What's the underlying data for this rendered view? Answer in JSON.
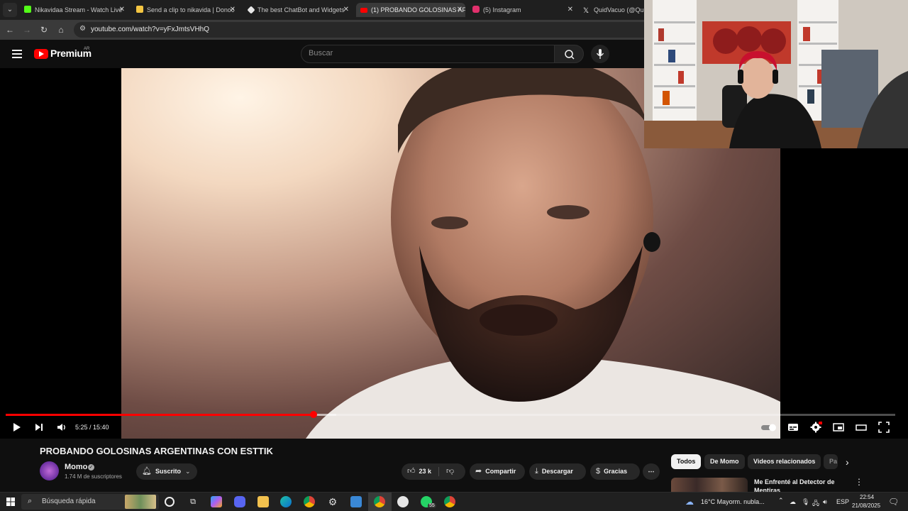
{
  "browser": {
    "tabs": [
      {
        "label": "Nikavidaa Stream - Watch Live",
        "favicon_color": "#53fc18",
        "active": false
      },
      {
        "label": "Send a clip to nikavida | Donoc",
        "favicon_color": "#f4c542",
        "active": false
      },
      {
        "label": "The best ChatBot and Widgets",
        "favicon_color": "#e8e8e8",
        "active": false
      },
      {
        "label": "(1) PROBANDO GOLOSINAS AF",
        "favicon_color": "#ff0000",
        "active": true
      },
      {
        "label": "(5) Instagram",
        "favicon_color": "#e1306c",
        "active": false
      },
      {
        "label": "QuidVacuo (@Quid",
        "favicon_color": "#e8e8e8",
        "active": false
      }
    ],
    "tab_close_glyph": "✕",
    "url": "youtube.com/watch?v=yFxJmtsVHhQ"
  },
  "youtube": {
    "brand": "Premium",
    "country": "AR",
    "search_placeholder": "Buscar"
  },
  "player": {
    "time": "5:25 / 15:40",
    "progress_fraction": 0.346,
    "buffer_fraction": 0.372
  },
  "video_info": {
    "title": "PROBANDO GOLOSINAS ARGENTINAS CON ESTTIK",
    "channel": "Momo",
    "subscribers": "1.74 M de suscriptores",
    "subscribed_label": "Suscrito",
    "likes": "23 k",
    "share_label": "Compartir",
    "download_label": "Descargar",
    "thanks_label": "Gracias"
  },
  "sidebar": {
    "chips": [
      "Todos",
      "De Momo",
      "Videos relacionados",
      "Pa"
    ],
    "related_title": "Me Enfrenté al Detector de Mentiras"
  },
  "taskbar": {
    "search_placeholder": "Búsqueda rápida",
    "weather": "16°C  Mayorm. nubla...",
    "language": "ESP",
    "time": "22:54",
    "date": "21/08/2025",
    "whatsapp_badge": "55"
  },
  "colors": {
    "accent": "#ff0000",
    "background": "#0f0f0f"
  }
}
